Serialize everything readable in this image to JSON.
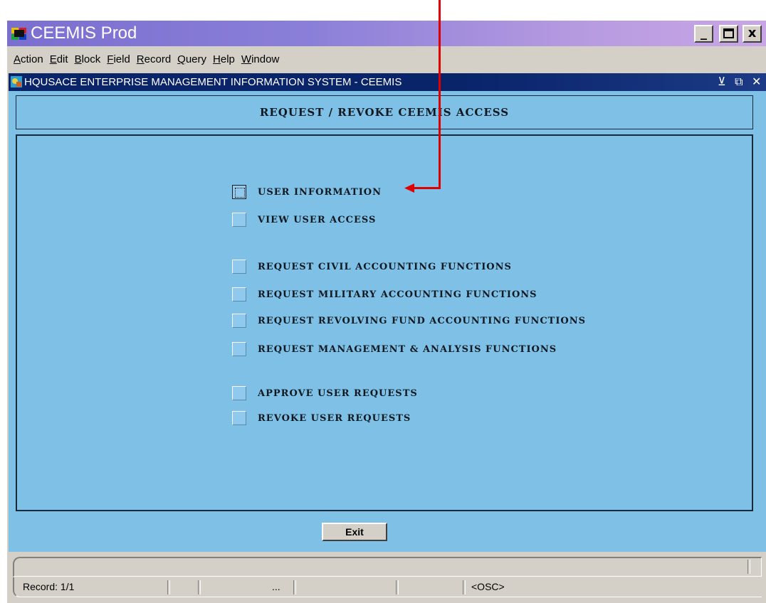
{
  "window": {
    "title": "CEEMIS Prod",
    "controls": {
      "minimize": "_",
      "maximize": "□",
      "close": "x"
    }
  },
  "menubar": {
    "items": [
      {
        "label": "Action"
      },
      {
        "label": "Edit"
      },
      {
        "label": "Block"
      },
      {
        "label": "Field"
      },
      {
        "label": "Record"
      },
      {
        "label": "Query"
      },
      {
        "label": "Help"
      },
      {
        "label": "Window"
      }
    ]
  },
  "inner_window": {
    "title": "HQUSACE ENTERPRISE MANAGEMENT INFORMATION SYSTEM - CEEMIS",
    "controls": "⊻ ⧉ ✕"
  },
  "form": {
    "header": "REQUEST / REVOKE CEEMIS ACCESS",
    "options": [
      {
        "label": "USER INFORMATION",
        "focused": true
      },
      {
        "label": "VIEW USER ACCESS"
      },
      {
        "label": "REQUEST CIVIL ACCOUNTING FUNCTIONS"
      },
      {
        "label": "REQUEST MILITARY ACCOUNTING FUNCTIONS"
      },
      {
        "label": "REQUEST REVOLVING FUND ACCOUNTING FUNCTIONS"
      },
      {
        "label": "REQUEST MANAGEMENT & ANALYSIS FUNCTIONS"
      },
      {
        "label": "APPROVE USER REQUESTS"
      },
      {
        "label": "REVOKE USER REQUESTS"
      }
    ],
    "exit_label": "Exit"
  },
  "status": {
    "record": "Record: 1/1",
    "ellipsis": "...",
    "mode": "<OSC>"
  },
  "colors": {
    "form_bg": "#7ec0e6",
    "annotation": "#e00000"
  }
}
